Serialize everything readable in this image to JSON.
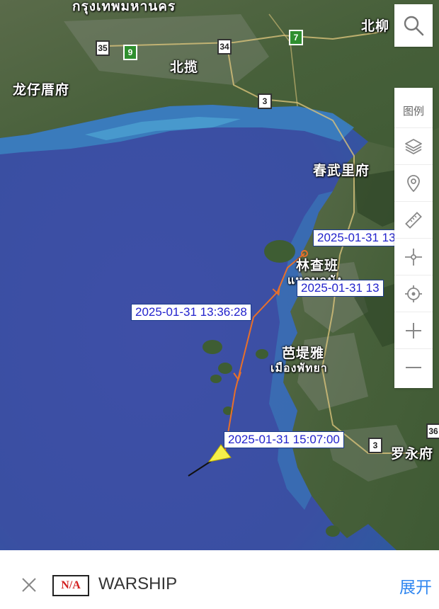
{
  "map": {
    "places": [
      {
        "id": "bangkok",
        "text": "กรุงเทพมหานคร"
      },
      {
        "id": "north-top",
        "text": "北柳"
      },
      {
        "id": "beilan",
        "text": "北揽"
      },
      {
        "id": "longzai",
        "text": "龙仔厝府"
      },
      {
        "id": "chonburi",
        "text": "春武里府"
      },
      {
        "id": "lincha",
        "text": "林查班"
      },
      {
        "id": "lincha-thai",
        "text": "แหลมฉบัง"
      },
      {
        "id": "pattaya",
        "text": "芭堤雅"
      },
      {
        "id": "pattaya-thai",
        "text": "เมืองพัทยา"
      },
      {
        "id": "rayong",
        "text": "罗永府"
      }
    ],
    "shields": [
      {
        "id": "r35",
        "text": "35",
        "style": "white"
      },
      {
        "id": "r9",
        "text": "9",
        "style": "green"
      },
      {
        "id": "r34",
        "text": "34",
        "style": "white"
      },
      {
        "id": "r7",
        "text": "7",
        "style": "green"
      },
      {
        "id": "r3a",
        "text": "3",
        "style": "white"
      },
      {
        "id": "r3b",
        "text": "3",
        "style": "white"
      },
      {
        "id": "r36",
        "text": "36",
        "style": "white"
      }
    ],
    "timestamps": [
      {
        "id": "ts1",
        "text": "2025-01-31 13:"
      },
      {
        "id": "ts2",
        "text": "2025-01-31 13"
      },
      {
        "id": "ts3",
        "text": "2025-01-31 13:36:28"
      },
      {
        "id": "ts4",
        "text": "2025-01-31 15:07:00"
      }
    ],
    "track_color": "#e8702a",
    "vessel_color": "#f5f04a"
  },
  "toolbar": {
    "legend_label": "图例",
    "buttons": [
      "layers-icon",
      "location-pin-icon",
      "ruler-icon",
      "crosshair-icon",
      "target-icon",
      "zoom-in-icon",
      "zoom-out-icon"
    ]
  },
  "bottom": {
    "flag_text": "N/A",
    "ship_name": "WARSHIP",
    "expand_label": "展开"
  },
  "colors": {
    "accent": "#2f86f0",
    "sea": "#3d52a8",
    "land": "#4e6b3a"
  }
}
